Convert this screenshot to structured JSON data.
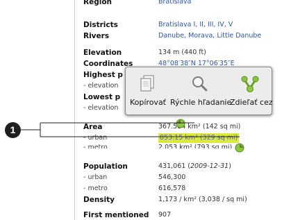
{
  "infobox": {
    "region": {
      "label": "Region",
      "value": "Bratislava"
    },
    "districts": {
      "label": "Districts",
      "value": "Bratislava I, II, III, IV, V"
    },
    "rivers": {
      "label": "Rivers",
      "value": "Danube, Morava, Little Danube"
    },
    "elevation": {
      "label": "Elevation",
      "value": "134 m (440 ft)"
    },
    "coordinates": {
      "label": "Coordinates",
      "value": "48°08′38″N 17°06′35″E"
    },
    "highest_point": {
      "label": "Highest p"
    },
    "highest_elevation": {
      "label": "- elevation"
    },
    "lowest_point": {
      "label": "Lowest p"
    },
    "lowest_elevation": {
      "label": "- elevation"
    },
    "area": {
      "label": "Area",
      "value": "367.584 km² (142 sq mi)"
    },
    "area_urban": {
      "label": "- urban",
      "value": "853.15 km² (329 sq mi)"
    },
    "area_metro": {
      "label": "- metro",
      "value": "2,053 km² (793 sq mi)"
    },
    "population": {
      "label": "Population",
      "value_number": "431,061 (",
      "value_date": "2009-12-31",
      "value_close": ")"
    },
    "pop_urban": {
      "label": "- urban",
      "value": "546,300"
    },
    "pop_metro": {
      "label": "- metro",
      "value": "616,578"
    },
    "density": {
      "label": "Density",
      "value": "1,173 / km² (3,038 / sq mi)"
    },
    "first_mentioned": {
      "label": "First mentioned",
      "value": "907"
    }
  },
  "popup": {
    "copy_label": "Kopírovať",
    "quick_search_label": "Rýchle hľadanie",
    "share_label": "Zdieľať cez",
    "copy_icon": "copy-icon",
    "search_icon": "magnifier-icon",
    "share_icon": "share-icon"
  },
  "callout": {
    "number": "1"
  },
  "colors": {
    "link": "#2a57b8",
    "highlight": "#dde93a",
    "handle": "#8ec63f"
  }
}
